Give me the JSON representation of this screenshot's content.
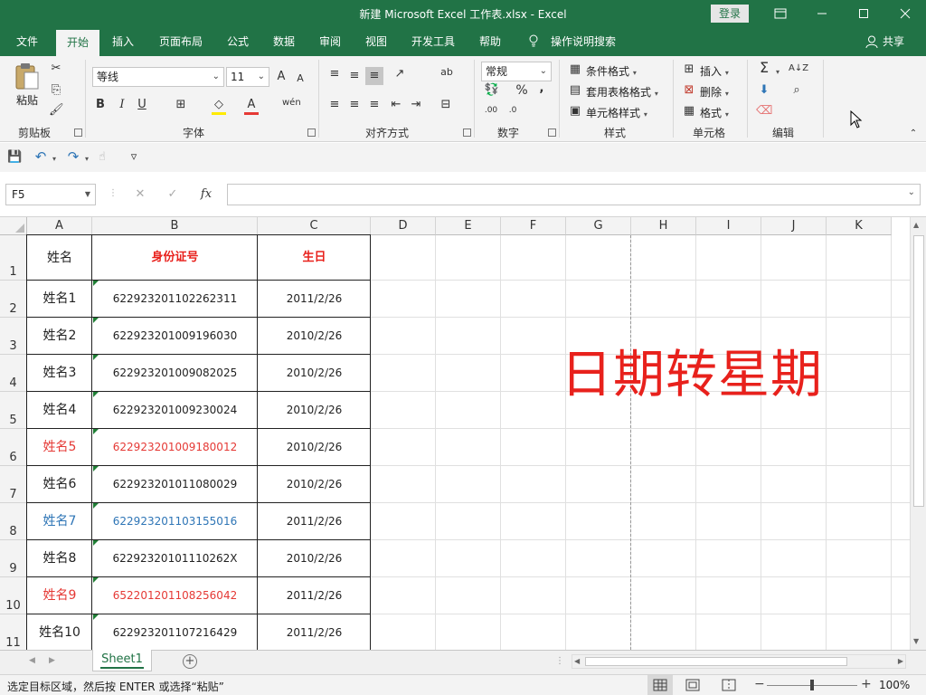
{
  "window": {
    "title": "新建 Microsoft Excel 工作表.xlsx  -  Excel",
    "login": "登录"
  },
  "tabs": [
    "文件",
    "开始",
    "插入",
    "页面布局",
    "公式",
    "数据",
    "审阅",
    "视图",
    "开发工具",
    "帮助"
  ],
  "search_label": "操作说明搜索",
  "share_label": "共享",
  "ribbon": {
    "paste_label": "粘贴",
    "groups": [
      "剪贴板",
      "字体",
      "对齐方式",
      "数字",
      "样式",
      "单元格",
      "编辑"
    ],
    "font_name": "等线",
    "font_size": "11",
    "number_format": "常规",
    "conditional_format": "条件格式",
    "format_as_table": "套用表格格式",
    "cell_styles": "单元格样式",
    "insert": "插入",
    "delete": "删除",
    "format": "格式",
    "bold": "B",
    "italic": "I",
    "underline": "U",
    "font_grow": "A",
    "font_shrink": "A",
    "percent": "%",
    "comma": ","
  },
  "formula_bar": {
    "name_box": "F5",
    "fx": "fx",
    "cancel": "✕",
    "enter": "✓",
    "value": ""
  },
  "columns": [
    "A",
    "B",
    "C",
    "D",
    "E",
    "F",
    "G",
    "H",
    "I",
    "J",
    "K"
  ],
  "rows": [
    "1",
    "2",
    "3",
    "4",
    "5",
    "6",
    "7",
    "8",
    "9",
    "10",
    "11"
  ],
  "table": {
    "header": [
      "姓名",
      "身份证号",
      "生日"
    ],
    "data": [
      {
        "name": "姓名1",
        "id": "622923201102262311",
        "birthday": "2011/2/26",
        "color": "#222222"
      },
      {
        "name": "姓名2",
        "id": "622923201009196030",
        "birthday": "2010/2/26",
        "color": "#222222"
      },
      {
        "name": "姓名3",
        "id": "622923201009082025",
        "birthday": "2010/2/26",
        "color": "#222222"
      },
      {
        "name": "姓名4",
        "id": "622923201009230024",
        "birthday": "2010/2/26",
        "color": "#222222"
      },
      {
        "name": "姓名5",
        "id": "622923201009180012",
        "birthday": "2010/2/26",
        "color": "#e53935"
      },
      {
        "name": "姓名6",
        "id": "622923201011080029",
        "birthday": "2010/2/26",
        "color": "#222222"
      },
      {
        "name": "姓名7",
        "id": "622923201103155016",
        "birthday": "2011/2/26",
        "color": "#2e75b6"
      },
      {
        "name": "姓名8",
        "id": "62292320101110262X",
        "birthday": "2010/2/26",
        "color": "#222222"
      },
      {
        "name": "姓名9",
        "id": "652201201108256042",
        "birthday": "2011/2/26",
        "color": "#e53935"
      },
      {
        "name": "姓名10",
        "id": "622923201107216429",
        "birthday": "2011/2/26",
        "color": "#222222"
      }
    ]
  },
  "overlay_text": "日期转星期",
  "sheet_tab": "Sheet1",
  "status_text": "选定目标区域，然后按 ENTER 或选择“粘贴”",
  "zoom": "100%",
  "colors": {
    "excel_green": "#217346",
    "header_red": "#e8211c",
    "overlay_red": "#e8211c"
  }
}
